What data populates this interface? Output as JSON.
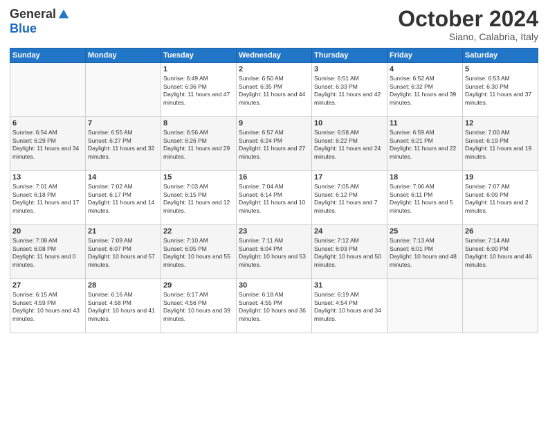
{
  "header": {
    "logo_general": "General",
    "logo_blue": "Blue",
    "month": "October 2024",
    "location": "Siano, Calabria, Italy"
  },
  "days_of_week": [
    "Sunday",
    "Monday",
    "Tuesday",
    "Wednesday",
    "Thursday",
    "Friday",
    "Saturday"
  ],
  "weeks": [
    [
      {
        "day": "",
        "sunrise": "",
        "sunset": "",
        "daylight": ""
      },
      {
        "day": "",
        "sunrise": "",
        "sunset": "",
        "daylight": ""
      },
      {
        "day": "1",
        "sunrise": "Sunrise: 6:49 AM",
        "sunset": "Sunset: 6:36 PM",
        "daylight": "Daylight: 11 hours and 47 minutes."
      },
      {
        "day": "2",
        "sunrise": "Sunrise: 6:50 AM",
        "sunset": "Sunset: 6:35 PM",
        "daylight": "Daylight: 11 hours and 44 minutes."
      },
      {
        "day": "3",
        "sunrise": "Sunrise: 6:51 AM",
        "sunset": "Sunset: 6:33 PM",
        "daylight": "Daylight: 11 hours and 42 minutes."
      },
      {
        "day": "4",
        "sunrise": "Sunrise: 6:52 AM",
        "sunset": "Sunset: 6:32 PM",
        "daylight": "Daylight: 11 hours and 39 minutes."
      },
      {
        "day": "5",
        "sunrise": "Sunrise: 6:53 AM",
        "sunset": "Sunset: 6:30 PM",
        "daylight": "Daylight: 11 hours and 37 minutes."
      }
    ],
    [
      {
        "day": "6",
        "sunrise": "Sunrise: 6:54 AM",
        "sunset": "Sunset: 6:29 PM",
        "daylight": "Daylight: 11 hours and 34 minutes."
      },
      {
        "day": "7",
        "sunrise": "Sunrise: 6:55 AM",
        "sunset": "Sunset: 6:27 PM",
        "daylight": "Daylight: 11 hours and 32 minutes."
      },
      {
        "day": "8",
        "sunrise": "Sunrise: 6:56 AM",
        "sunset": "Sunset: 6:26 PM",
        "daylight": "Daylight: 11 hours and 29 minutes."
      },
      {
        "day": "9",
        "sunrise": "Sunrise: 6:57 AM",
        "sunset": "Sunset: 6:24 PM",
        "daylight": "Daylight: 11 hours and 27 minutes."
      },
      {
        "day": "10",
        "sunrise": "Sunrise: 6:58 AM",
        "sunset": "Sunset: 6:22 PM",
        "daylight": "Daylight: 11 hours and 24 minutes."
      },
      {
        "day": "11",
        "sunrise": "Sunrise: 6:59 AM",
        "sunset": "Sunset: 6:21 PM",
        "daylight": "Daylight: 11 hours and 22 minutes."
      },
      {
        "day": "12",
        "sunrise": "Sunrise: 7:00 AM",
        "sunset": "Sunset: 6:19 PM",
        "daylight": "Daylight: 11 hours and 19 minutes."
      }
    ],
    [
      {
        "day": "13",
        "sunrise": "Sunrise: 7:01 AM",
        "sunset": "Sunset: 6:18 PM",
        "daylight": "Daylight: 11 hours and 17 minutes."
      },
      {
        "day": "14",
        "sunrise": "Sunrise: 7:02 AM",
        "sunset": "Sunset: 6:17 PM",
        "daylight": "Daylight: 11 hours and 14 minutes."
      },
      {
        "day": "15",
        "sunrise": "Sunrise: 7:03 AM",
        "sunset": "Sunset: 6:15 PM",
        "daylight": "Daylight: 11 hours and 12 minutes."
      },
      {
        "day": "16",
        "sunrise": "Sunrise: 7:04 AM",
        "sunset": "Sunset: 6:14 PM",
        "daylight": "Daylight: 11 hours and 10 minutes."
      },
      {
        "day": "17",
        "sunrise": "Sunrise: 7:05 AM",
        "sunset": "Sunset: 6:12 PM",
        "daylight": "Daylight: 11 hours and 7 minutes."
      },
      {
        "day": "18",
        "sunrise": "Sunrise: 7:06 AM",
        "sunset": "Sunset: 6:11 PM",
        "daylight": "Daylight: 11 hours and 5 minutes."
      },
      {
        "day": "19",
        "sunrise": "Sunrise: 7:07 AM",
        "sunset": "Sunset: 6:09 PM",
        "daylight": "Daylight: 11 hours and 2 minutes."
      }
    ],
    [
      {
        "day": "20",
        "sunrise": "Sunrise: 7:08 AM",
        "sunset": "Sunset: 6:08 PM",
        "daylight": "Daylight: 11 hours and 0 minutes."
      },
      {
        "day": "21",
        "sunrise": "Sunrise: 7:09 AM",
        "sunset": "Sunset: 6:07 PM",
        "daylight": "Daylight: 10 hours and 57 minutes."
      },
      {
        "day": "22",
        "sunrise": "Sunrise: 7:10 AM",
        "sunset": "Sunset: 6:05 PM",
        "daylight": "Daylight: 10 hours and 55 minutes."
      },
      {
        "day": "23",
        "sunrise": "Sunrise: 7:11 AM",
        "sunset": "Sunset: 6:04 PM",
        "daylight": "Daylight: 10 hours and 53 minutes."
      },
      {
        "day": "24",
        "sunrise": "Sunrise: 7:12 AM",
        "sunset": "Sunset: 6:03 PM",
        "daylight": "Daylight: 10 hours and 50 minutes."
      },
      {
        "day": "25",
        "sunrise": "Sunrise: 7:13 AM",
        "sunset": "Sunset: 6:01 PM",
        "daylight": "Daylight: 10 hours and 48 minutes."
      },
      {
        "day": "26",
        "sunrise": "Sunrise: 7:14 AM",
        "sunset": "Sunset: 6:00 PM",
        "daylight": "Daylight: 10 hours and 46 minutes."
      }
    ],
    [
      {
        "day": "27",
        "sunrise": "Sunrise: 6:15 AM",
        "sunset": "Sunset: 4:59 PM",
        "daylight": "Daylight: 10 hours and 43 minutes."
      },
      {
        "day": "28",
        "sunrise": "Sunrise: 6:16 AM",
        "sunset": "Sunset: 4:58 PM",
        "daylight": "Daylight: 10 hours and 41 minutes."
      },
      {
        "day": "29",
        "sunrise": "Sunrise: 6:17 AM",
        "sunset": "Sunset: 4:56 PM",
        "daylight": "Daylight: 10 hours and 39 minutes."
      },
      {
        "day": "30",
        "sunrise": "Sunrise: 6:18 AM",
        "sunset": "Sunset: 4:55 PM",
        "daylight": "Daylight: 10 hours and 36 minutes."
      },
      {
        "day": "31",
        "sunrise": "Sunrise: 6:19 AM",
        "sunset": "Sunset: 4:54 PM",
        "daylight": "Daylight: 10 hours and 34 minutes."
      },
      {
        "day": "",
        "sunrise": "",
        "sunset": "",
        "daylight": ""
      },
      {
        "day": "",
        "sunrise": "",
        "sunset": "",
        "daylight": ""
      }
    ]
  ]
}
